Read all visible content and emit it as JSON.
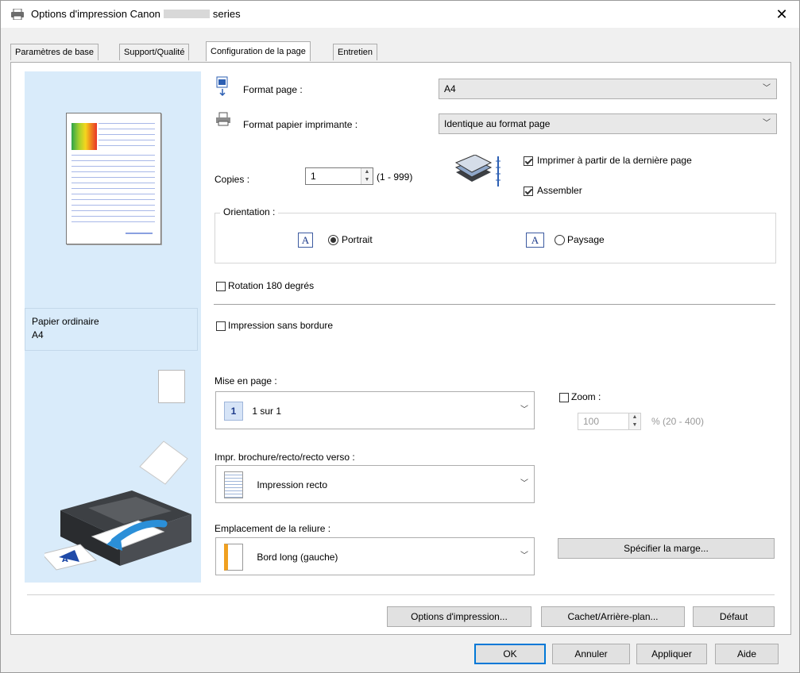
{
  "window": {
    "title_prefix": "Options d'impression Canon",
    "title_suffix": "series",
    "close_glyph": "✕",
    "printer_icon": "printer-icon"
  },
  "tabs": [
    "Paramètres de base",
    "Support/Qualité",
    "Configuration de la page",
    "Entretien"
  ],
  "active_tab": "Configuration de la page",
  "preview": {
    "media_line1": "Papier ordinaire",
    "media_line2": "A4"
  },
  "page_size": {
    "label": "Format page :",
    "value": "A4"
  },
  "printer_paper_size": {
    "label": "Format papier imprimante :",
    "value": "Identique au format page"
  },
  "copies": {
    "label": "Copies :",
    "value": "1",
    "range": "(1 - 999)"
  },
  "print_from_last_page": {
    "label": "Imprimer à partir de la dernière page",
    "checked": true
  },
  "collate": {
    "label": "Assembler",
    "checked": true
  },
  "orientation": {
    "title": "Orientation :",
    "portrait": "Portrait",
    "landscape": "Paysage",
    "selected": "Portrait",
    "icon_glyph": "A"
  },
  "rotate_180": {
    "label": "Rotation 180 degrés",
    "checked": false
  },
  "borderless": {
    "label": "Impression sans bordure",
    "checked": false
  },
  "page_layout": {
    "label": "Mise en page :",
    "value": "1 sur 1",
    "icon_text": "1"
  },
  "zoom": {
    "label": "Zoom :",
    "checked": false,
    "value": "100",
    "range": "% (20 - 400)"
  },
  "duplex": {
    "label": "Impr. brochure/recto/recto verso :",
    "value": "Impression recto"
  },
  "binding": {
    "label": "Emplacement de la reliure :",
    "value": "Bord long (gauche)"
  },
  "buttons": {
    "specify_margin": "Spécifier la marge...",
    "print_options": "Options d'impression...",
    "stamp_background": "Cachet/Arrière-plan...",
    "defaults": "Défaut",
    "ok": "OK",
    "cancel": "Annuler",
    "apply": "Appliquer",
    "help": "Aide"
  },
  "colors": {
    "accent": "#0078d7",
    "preview_bg": "#d9ebfa"
  }
}
